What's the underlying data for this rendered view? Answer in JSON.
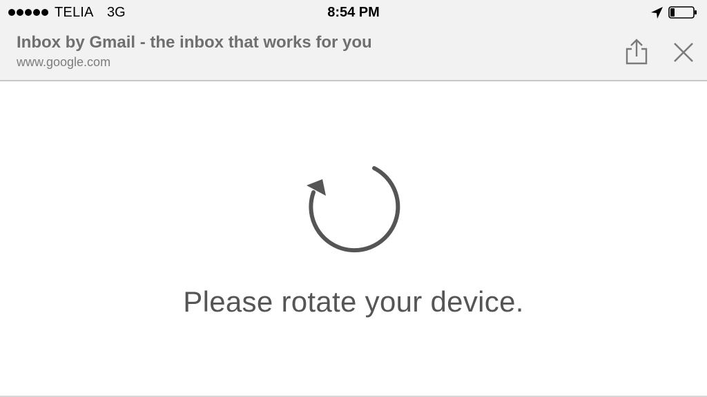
{
  "status_bar": {
    "signal_bars": 5,
    "carrier": "TELIA",
    "network": "3G",
    "time": "8:54 PM",
    "location_icon": "location-arrow-icon",
    "battery_level": 0.2
  },
  "browser": {
    "page_title": "Inbox by Gmail - the inbox that works for you",
    "url": "www.google.com",
    "share_icon": "share-icon",
    "close_icon": "close-icon"
  },
  "content": {
    "icon": "rotate-icon",
    "message": "Please rotate your device."
  },
  "colors": {
    "header_background": "#f2f2f2",
    "title_text": "#6f6f6f",
    "icon_gray": "#555555",
    "divider": "#c8c8c8"
  }
}
